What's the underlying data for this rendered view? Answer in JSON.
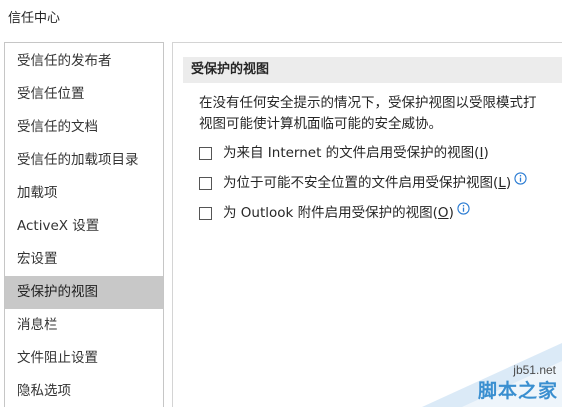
{
  "window": {
    "title": "信任中心"
  },
  "sidebar": {
    "items": [
      {
        "label": "受信任的发布者"
      },
      {
        "label": "受信任位置"
      },
      {
        "label": "受信任的文档"
      },
      {
        "label": "受信任的加载项目录"
      },
      {
        "label": "加载项"
      },
      {
        "label": "ActiveX 设置"
      },
      {
        "label": "宏设置"
      },
      {
        "label": "受保护的视图",
        "selected": true
      },
      {
        "label": "消息栏"
      },
      {
        "label": "文件阻止设置"
      },
      {
        "label": "隐私选项"
      }
    ]
  },
  "main": {
    "section_title": "受保护的视图",
    "description_lines": [
      "在没有任何安全提示的情况下，受保护视图以受限模式打",
      "视图可能使计算机面临可能的安全威协。"
    ],
    "options": [
      {
        "text_before": "为来自 Internet 的文件启用受保护的视图(",
        "hotkey": "I",
        "text_after": ")",
        "checked": false,
        "info": false
      },
      {
        "text_before": "为位于可能不安全位置的文件启用受保护视图(",
        "hotkey": "L",
        "text_after": ")",
        "checked": false,
        "info": true
      },
      {
        "text_before": "为 Outlook 附件启用受保护的视图(",
        "hotkey": "O",
        "text_after": ")",
        "checked": false,
        "info": true
      }
    ]
  },
  "watermark": {
    "url": "jb51.net",
    "name": "脚本之家"
  },
  "colors": {
    "selected_bg": "#c8c8c8",
    "header_bg": "#ececec",
    "info_icon": "#2b7cd3",
    "watermark_accent": "#3a8fd0"
  },
  "icons": {
    "info": "info-icon",
    "checkbox": "checkbox-icon"
  }
}
